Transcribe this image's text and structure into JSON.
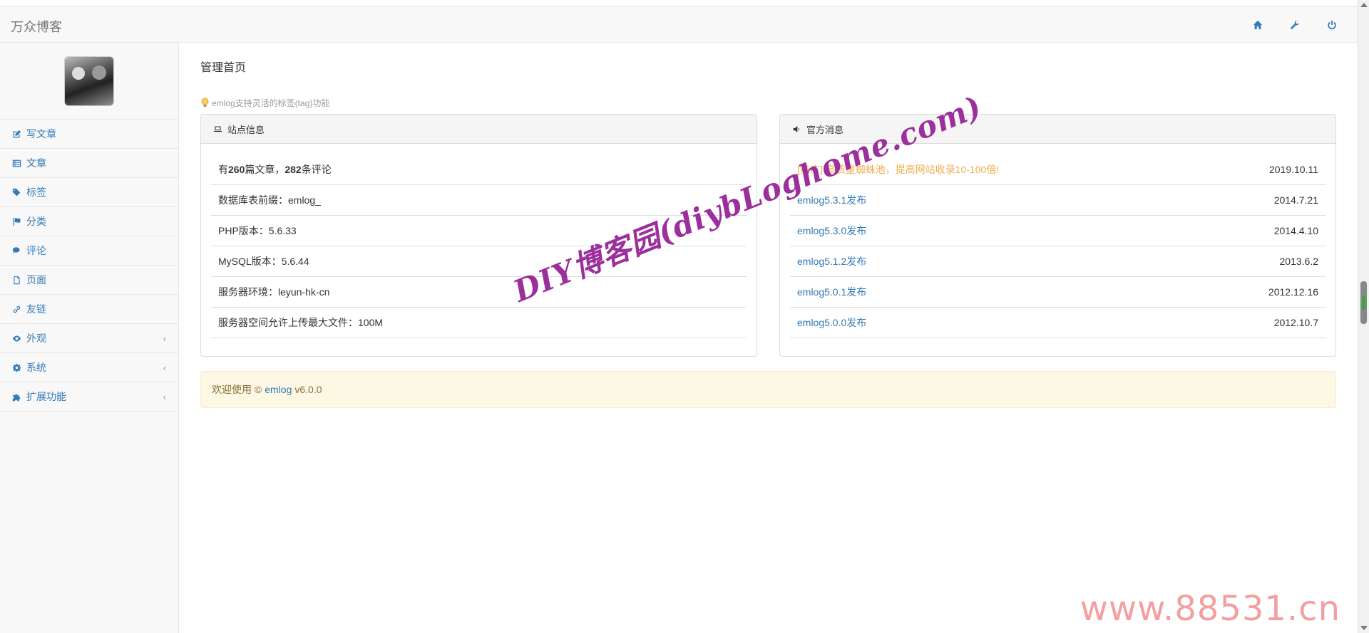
{
  "navbar": {
    "brand": "万众博客",
    "icons": [
      "home-icon",
      "wrench-icon",
      "power-icon"
    ]
  },
  "sidebar": {
    "items": [
      {
        "label": "写文章",
        "icon": "pencil-square-icon",
        "has_submenu": false
      },
      {
        "label": "文章",
        "icon": "list-icon",
        "has_submenu": false
      },
      {
        "label": "标签",
        "icon": "tags-icon",
        "has_submenu": false
      },
      {
        "label": "分类",
        "icon": "flag-icon",
        "has_submenu": false
      },
      {
        "label": "评论",
        "icon": "comments-icon",
        "has_submenu": false
      },
      {
        "label": "页面",
        "icon": "file-icon",
        "has_submenu": false
      },
      {
        "label": "友链",
        "icon": "link-icon",
        "has_submenu": false
      },
      {
        "label": "外观",
        "icon": "eye-icon",
        "has_submenu": true
      },
      {
        "label": "系统",
        "icon": "gear-icon",
        "has_submenu": true
      },
      {
        "label": "扩展功能",
        "icon": "puzzle-icon",
        "has_submenu": true
      }
    ],
    "chevron": "‹"
  },
  "main": {
    "title": "管理首页",
    "tip": "emlog支持灵活的标签(tag)功能",
    "site_info": {
      "heading": "站点信息",
      "stats": {
        "prefix": "有",
        "posts": "260",
        "mid": "篇文章，",
        "comments": "282",
        "suffix": "条评论"
      },
      "rows": [
        "数据库表前缀：emlog_",
        "PHP版本：5.6.33",
        "MySQL版本：5.6.44",
        "服务器环境：leyun-hk-cn",
        "服务器空间允许上传最大文件：100M"
      ]
    },
    "news": {
      "heading": "官方消息",
      "items": [
        {
          "title": "[推广] 高质量蜘蛛池，提高网站收录10-100倍!",
          "date": "2019.10.11",
          "promo": true
        },
        {
          "title": "emlog5.3.1发布",
          "date": "2014.7.21",
          "promo": false
        },
        {
          "title": "emlog5.3.0发布",
          "date": "2014.4.10",
          "promo": false
        },
        {
          "title": "emlog5.1.2发布",
          "date": "2013.6.2",
          "promo": false
        },
        {
          "title": "emlog5.0.1发布",
          "date": "2012.12.16",
          "promo": false
        },
        {
          "title": "emlog5.0.0发布",
          "date": "2012.10.7",
          "promo": false
        }
      ]
    },
    "welcome": {
      "prefix": "欢迎使用 ©",
      "link": "emlog",
      "version": "v6.0.0"
    }
  },
  "watermarks": {
    "diagonal": "DIY博客园(diybLoghome.com)",
    "corner": "www.88531.cn"
  }
}
